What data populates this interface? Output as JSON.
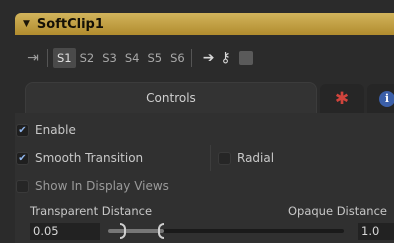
{
  "titlebar": {
    "title": "SoftClip1"
  },
  "toolbar": {
    "tabs": [
      "S1",
      "S2",
      "S3",
      "S4",
      "S5",
      "S6"
    ],
    "active_tab": "S1"
  },
  "tabs": {
    "controls": "Controls"
  },
  "options": {
    "enable": {
      "label": "Enable",
      "checked": true
    },
    "smooth": {
      "label": "Smooth Transition",
      "checked": true
    },
    "radial": {
      "label": "Radial",
      "checked": false
    },
    "show": {
      "label": "Show In Display Views",
      "checked": false
    }
  },
  "range": {
    "transparent_label": "Transparent Distance",
    "opaque_label": "Opaque Distance",
    "transparent_value": "0.05",
    "opaque_value": "1.0",
    "transparent_fraction": 0.05,
    "opaque_fraction": 1.0
  }
}
